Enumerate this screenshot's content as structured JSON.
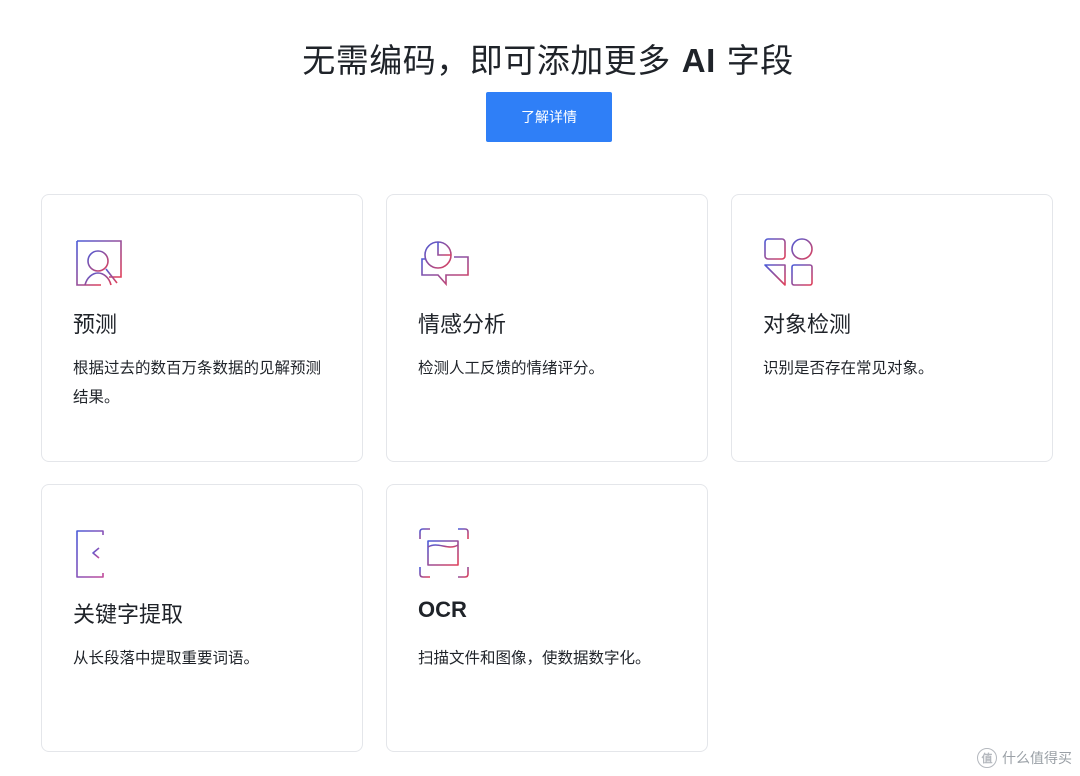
{
  "header": {
    "title_prefix": "无需编码，即可添加更多 ",
    "title_ai": "AI",
    "title_suffix": " 字段",
    "cta_label": "了解详情"
  },
  "cards": [
    {
      "icon": "predict-icon",
      "title": "预测",
      "desc": "根据过去的数百万条数据的见解预测结果。"
    },
    {
      "icon": "sentiment-icon",
      "title": "情感分析",
      "desc": "检测人工反馈的情绪评分。"
    },
    {
      "icon": "object-detection-icon",
      "title": "对象检测",
      "desc": "识别是否存在常见对象。"
    },
    {
      "icon": "keyword-extraction-icon",
      "title": "关键字提取",
      "desc": "从长段落中提取重要词语。"
    },
    {
      "icon": "ocr-icon",
      "title": "OCR",
      "desc": "扫描文件和图像，使数据数字化。"
    }
  ],
  "watermark": {
    "symbol": "值",
    "text": "什么值得买"
  },
  "colors": {
    "accent": "#2f7ff7",
    "icon_gradient_start": "#4b5bd8",
    "icon_gradient_end": "#e0405a",
    "card_border": "#e4e6ea"
  }
}
